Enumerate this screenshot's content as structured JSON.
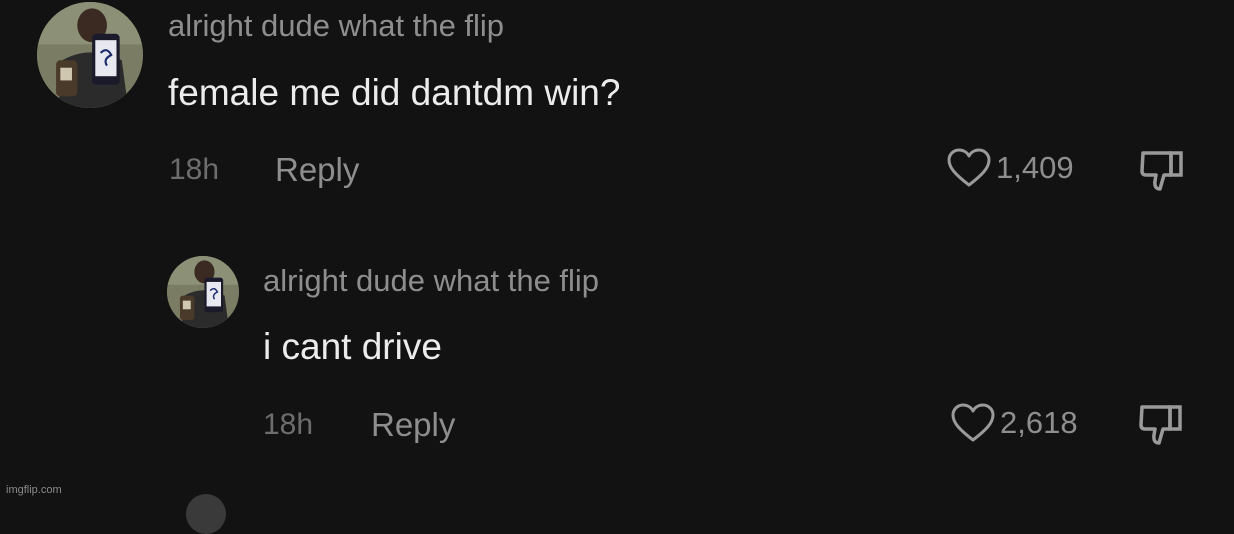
{
  "comments": [
    {
      "username": "alright dude what the flip",
      "text": "female me did dantdm win?",
      "timestamp": "18h",
      "reply_label": "Reply",
      "likes": "1,409",
      "like_icon": "heart-icon",
      "dislike_icon": "thumbs-down-icon"
    },
    {
      "username": "alright dude what the flip",
      "text": "i cant drive",
      "timestamp": "18h",
      "reply_label": "Reply",
      "likes": "2,618",
      "like_icon": "heart-icon",
      "dislike_icon": "thumbs-down-icon"
    }
  ],
  "watermark": "imgflip.com",
  "colors": {
    "background": "#121212",
    "username": "#8e8e8e",
    "comment_text": "#ececec",
    "meta": "#8e8e8e"
  }
}
